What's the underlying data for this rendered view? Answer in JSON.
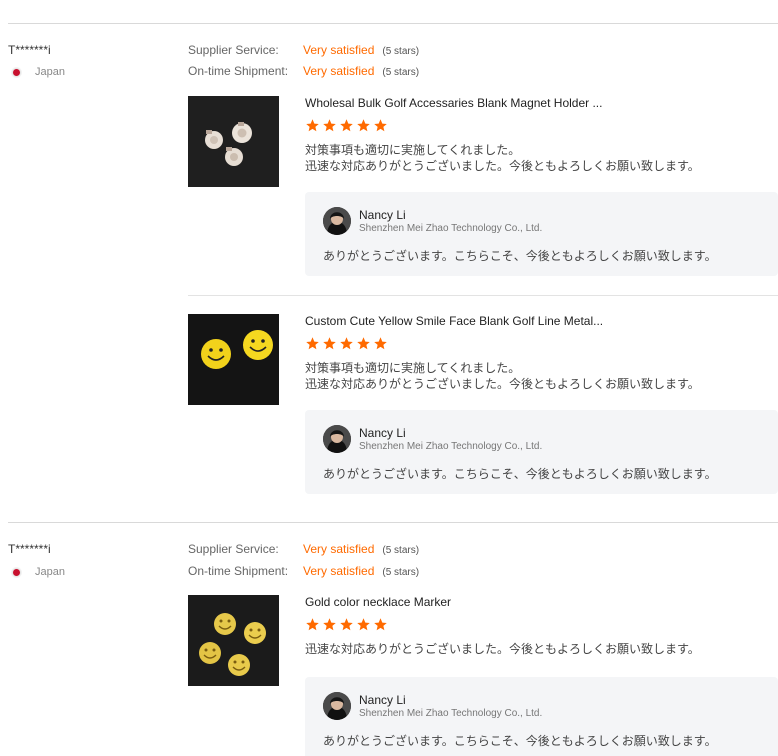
{
  "reviews": [
    {
      "buyer": "T*******i",
      "country": "Japan",
      "supplier_service_label": "Supplier Service:",
      "supplier_service_value": "Very satisfied",
      "supplier_service_stars": "(5 stars)",
      "shipment_label": "On-time Shipment:",
      "shipment_value": "Very satisfied",
      "shipment_stars": "(5 stars)",
      "products": [
        {
          "title": "Wholesal Bulk Golf Accessaries Blank Magnet Holder ...",
          "rating": 5,
          "text_line1": "対策事項も適切に実施してくれました。",
          "text_line2": "迅速な対応ありがとうございました。今後ともよろしくお願い致します。",
          "reply_name": "Nancy Li",
          "reply_company": "Shenzhen Mei Zhao Technology Co., Ltd.",
          "reply_text": "ありがとうございます。こちらこそ、今後ともよろしくお願い致します。"
        },
        {
          "title": "Custom Cute Yellow Smile Face Blank Golf Line Metal...",
          "rating": 5,
          "text_line1": "対策事項も適切に実施してくれました。",
          "text_line2": "迅速な対応ありがとうございました。今後ともよろしくお願い致します。",
          "reply_name": "Nancy Li",
          "reply_company": "Shenzhen Mei Zhao Technology Co., Ltd.",
          "reply_text": "ありがとうございます。こちらこそ、今後ともよろしくお願い致します。"
        }
      ]
    },
    {
      "buyer": "T*******i",
      "country": "Japan",
      "supplier_service_label": "Supplier Service:",
      "supplier_service_value": "Very satisfied",
      "supplier_service_stars": "(5 stars)",
      "shipment_label": "On-time Shipment:",
      "shipment_value": "Very satisfied",
      "shipment_stars": "(5 stars)",
      "products": [
        {
          "title": "Gold color necklace Marker",
          "rating": 5,
          "text_line1": "迅速な対応ありがとうございました。今後ともよろしくお願い致します。",
          "reply_name": "Nancy Li",
          "reply_company": "Shenzhen Mei Zhao Technology Co., Ltd.",
          "reply_text": "ありがとうございます。こちらこそ、今後ともよろしくお願い致します。"
        }
      ]
    }
  ],
  "colors": {
    "accent": "#ff6a00",
    "star": "#ff6a00",
    "reply_bg": "#f4f5f7"
  }
}
